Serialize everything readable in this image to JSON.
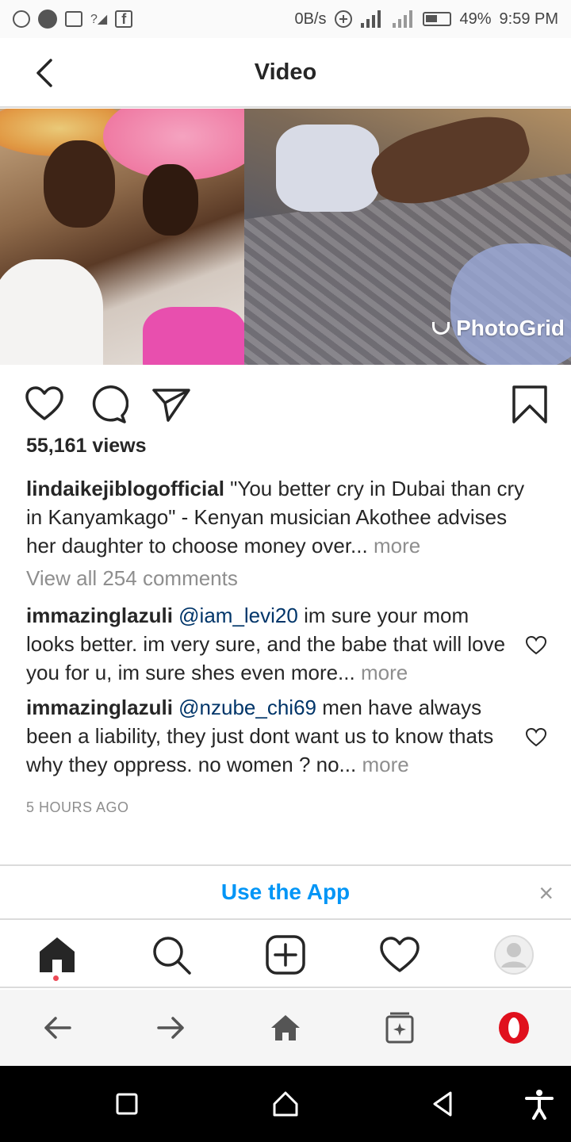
{
  "status_bar": {
    "network_speed": "0B/s",
    "battery_percent": "49%",
    "time": "9:59 PM"
  },
  "header": {
    "title": "Video"
  },
  "media": {
    "watermark": "PhotoGrid"
  },
  "post": {
    "views": "55,161 views",
    "caption_user": "lindaikejiblogofficial",
    "caption_text": "\"You better cry in Dubai than cry in Kanyamkago\" - Kenyan musician Akothee advises her daughter to choose money over...",
    "caption_more": "more",
    "view_all_comments": "View all 254 comments",
    "comments": [
      {
        "user": "immazinglazuli",
        "mention": "@iam_levi20",
        "text": "im sure your mom looks better. im very sure, and the babe that will love you for u, im sure shes even more...",
        "more": "more"
      },
      {
        "user": "immazinglazuli",
        "mention": "@nzube_chi69",
        "text": "men have always been a liability, they just dont want us to know thats why they oppress. no women ? no...",
        "more": "more"
      }
    ],
    "time_ago": "5 HOURS AGO"
  },
  "app_banner": {
    "label": "Use the App",
    "close": "×"
  },
  "colors": {
    "link_blue": "#0095f6",
    "mention_blue": "#003569",
    "muted": "#8e8e8e",
    "text": "#262626",
    "active_dot": "#ed4956",
    "opera_red": "#e0101d"
  }
}
